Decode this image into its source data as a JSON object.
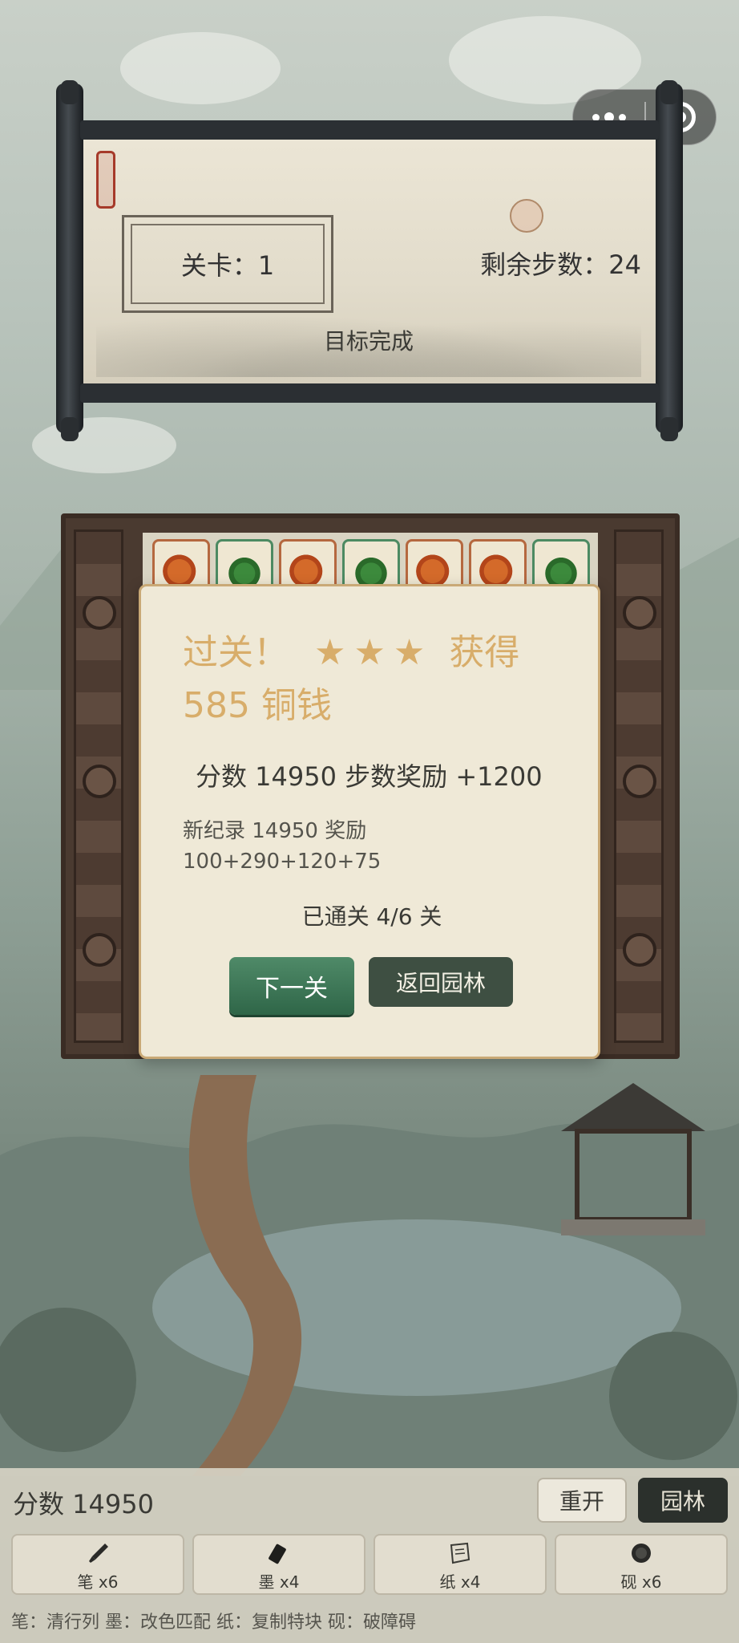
{
  "header": {
    "level_label": "关卡：1",
    "steps_label": "剩余步数：24",
    "goal_label": "目标完成"
  },
  "board": {
    "top_row_tiles": [
      "fish",
      "leaf",
      "fish",
      "leaf",
      "fish",
      "fish",
      "leaf"
    ]
  },
  "dialog": {
    "title_prefix": "过关！",
    "stars": "★★★",
    "reward_prefix": "获得",
    "reward_amount": "585 铜钱",
    "score_line": "分数 14950  步数奖励 +1200",
    "record_line_1": "新纪录 14950  奖励",
    "record_line_2": "100+290+120+75",
    "cleared_line": "已通关 4/6 关",
    "next_button": "下一关",
    "back_button": "返回园林"
  },
  "footer": {
    "score_label": "分数 14950",
    "restart_button": "重开",
    "garden_button": "园林",
    "tools": [
      {
        "icon": "brush-icon",
        "label": "笔 x6"
      },
      {
        "icon": "ink-stick-icon",
        "label": "墨 x4"
      },
      {
        "icon": "paper-icon",
        "label": "纸 x4"
      },
      {
        "icon": "inkstone-icon",
        "label": "砚 x6"
      }
    ],
    "hint": "笔：清行列  墨：改色匹配  纸：复制特块  砚：破障碍"
  }
}
